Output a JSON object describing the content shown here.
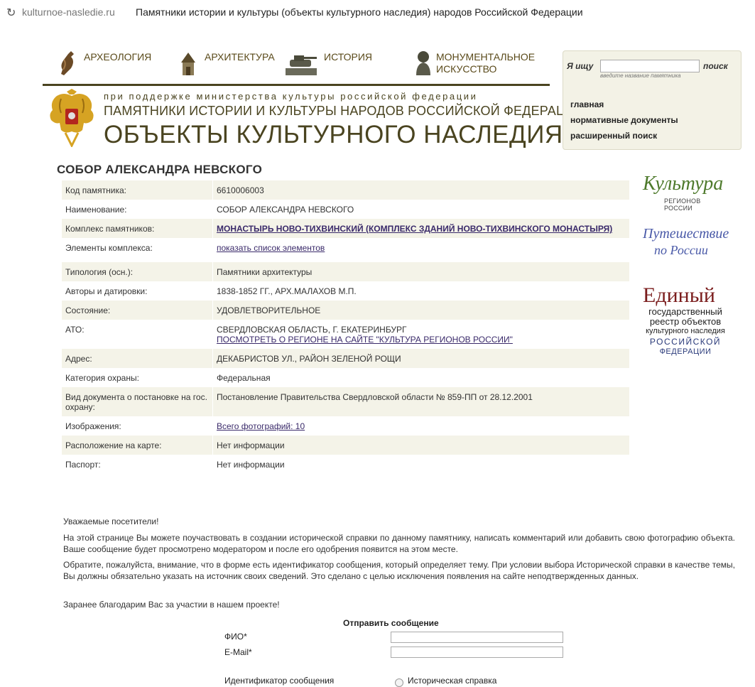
{
  "browser": {
    "domain": "kulturnoe-nasledie.ru",
    "title": "Памятники истории и культуры (объекты культурного наследия) народов Российской Федерации"
  },
  "nav": [
    {
      "label1": "АРХЕОЛОГИЯ",
      "label2": "",
      "icon": "amphora-icon"
    },
    {
      "label1": "АРХИТЕКТУРА",
      "label2": "",
      "icon": "tower-icon"
    },
    {
      "label1": "ИСТОРИЯ",
      "label2": "",
      "icon": "tank-monument-icon"
    },
    {
      "label1": "МОНУМЕНТАЛЬНОЕ",
      "label2": "ИСКУССТВО",
      "icon": "bust-icon"
    }
  ],
  "header": {
    "support": "при поддержке министерства культуры российской федерации",
    "subtitle": "ПАМЯТНИКИ ИСТОРИИ И КУЛЬТУРЫ НАРОДОВ РОССИЙСКОЙ ФЕДЕРАЦИИ",
    "title": "ОБЪЕКТЫ КУЛЬТУРНОГО НАСЛЕДИЯ"
  },
  "search": {
    "label": "Я ищу",
    "button": "поиск",
    "hint": "введите название памятника",
    "value": "",
    "links": [
      "главная",
      "нормативные документы",
      "расширенный поиск"
    ]
  },
  "page_title": "СОБОР АЛЕКСАНДРА НЕВСКОГО",
  "rows": {
    "code": {
      "k": "Код памятника:",
      "v": "6610006003"
    },
    "name": {
      "k": "Наименование:",
      "v": "СОБОР АЛЕКСАНДРА НЕВСКОГО"
    },
    "complex": {
      "k": "Комплекс памятников:",
      "v": "МОНАСТЫРЬ НОВО-ТИХВИНСКИЙ (КОМПЛЕКС ЗДАНИЙ НОВО-ТИХВИНСКОГО МОНАСТЫРЯ)"
    },
    "elements": {
      "k": "Элементы комплекса:",
      "v": "показать список элементов"
    },
    "typology": {
      "k": "Типология (осн.):",
      "v": "Памятники архитектуры"
    },
    "authors": {
      "k": "Авторы и датировки:",
      "v": "1838-1852 ГГ., АРХ.МАЛАХОВ М.П."
    },
    "state": {
      "k": "Состояние:",
      "v": "УДОВЛЕТВОРИТЕЛЬНОЕ"
    },
    "ato": {
      "k": "АТО:",
      "v": "СВЕРДЛОВСКАЯ ОБЛАСТЬ, Г. ЕКАТЕРИНБУРГ",
      "link": "ПОСМОТРЕТЬ О РЕГИОНЕ НА САЙТЕ \"КУЛЬТУРА РЕГИОНОВ РОССИИ\""
    },
    "address": {
      "k": "Адрес:",
      "v": "ДЕКАБРИСТОВ УЛ., РАЙОН ЗЕЛЕНОЙ РОЩИ"
    },
    "category": {
      "k": "Категория охраны:",
      "v": "Федеральная"
    },
    "document": {
      "k": "Вид документа о постановке на гос. охрану:",
      "v": "Постановление Правительства Свердловской области № 859-ПП от 28.12.2001"
    },
    "images": {
      "k": "Изображения:",
      "v": "Всего фотографий: 10"
    },
    "map": {
      "k": "Расположение на карте:",
      "v": "Нет информации"
    },
    "passport": {
      "k": "Паспорт:",
      "v": "Нет информации"
    }
  },
  "logos": {
    "kultura_1": "Культура",
    "kultura_2": "РЕГИОНОВ РОССИИ",
    "travel_1": "Путешествие",
    "travel_2": "по России",
    "reestr_1": "Единый",
    "reestr_2": "государственный",
    "reestr_3": "реестр объектов",
    "reestr_4": "культурного наследия",
    "reestr_5": "РОССИЙСКОЙ",
    "reestr_6": "ФЕДЕРАЦИИ"
  },
  "notice": {
    "greeting": "Уважаемые посетители!",
    "p1": "На этой странице Вы можете поучаствовать в создании исторической справки по данному памятнику, написать комментарий или добавить свою фотографию объекта. Ваше сообщение будет просмотрено модератором и после его одобрения появится на этом месте.",
    "p2": "Обратите, пожалуйста, внимание, что в форме есть идентификатор сообщения, который определяет тему. При условии выбора Исторической справки в качестве темы, Вы должны обязательно указать на источник своих сведений. Это сделано с целью исключения появления на сайте неподтвержденных данных.",
    "p3": "Заранее благодарим Вас за участии в нашем проекте!"
  },
  "form": {
    "title": "Отправить сообщение",
    "fio_label": "ФИО*",
    "email_label": "E-Mail*",
    "id_label": "Идентификатор сообщения",
    "radio_label": "Историческая справка"
  },
  "colors": {
    "accent": "#4a4420",
    "row": "#f4f3e8",
    "link": "#3a2a6a",
    "kultura": "#4e7a2c",
    "reestr": "#7a1c1c",
    "reestr_blue": "#2a3a7a"
  }
}
